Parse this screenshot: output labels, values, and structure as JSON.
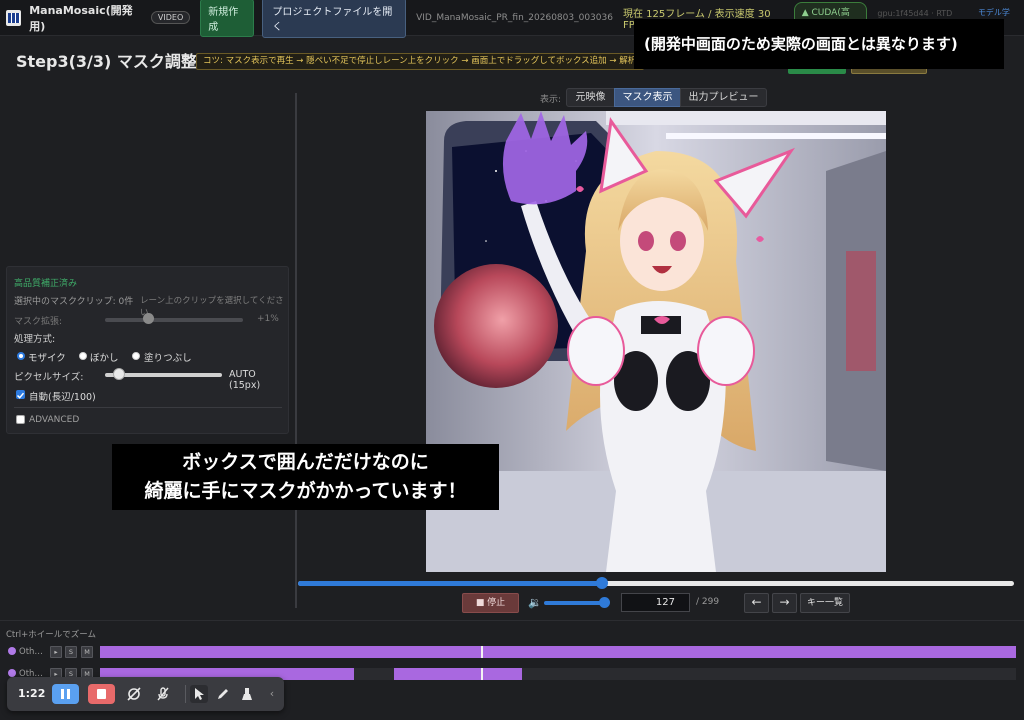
{
  "header": {
    "app_name": "ManaMosaic(開発用)",
    "badge": "VIDEO",
    "new_project_label": "新規作成",
    "open_project_label": "プロジェクトファイルを開く",
    "filename": "VID_ManaMosaic_PR_fin_20260803_003036",
    "frame_status": "現在 125フレーム / 表示速度 30 FPS",
    "cuda_label": "▲ CUDA(高速)",
    "gpu_info": "gpu:1f45d44 · RTD 121/56",
    "model_link": "モデル学習"
  },
  "step": {
    "title": "Step3(3/3) マスク調整",
    "tip": "コツ: マスク表示で再生 → 隠ぺい不足で停止しレーン上をクリック → 画面上でドラッグしてボックス追加 → 解析"
  },
  "overlay": {
    "dev_notice": "(開発中画面のため実際の画面とは異なります)",
    "caption_line1": "ボックスで囲んだだけなのに",
    "caption_line2": "綺麗に手にマスクがかかっています！"
  },
  "left_panel": {
    "status": "高品質補正済み",
    "selected_count": "選択中のマスククリップ: 0件",
    "selected_hint": "レーン上のクリップを選択してください",
    "mask_expand_label": "マスク拡張:",
    "mask_expand_value": "+1%",
    "mask_expand_fraction": 0.28,
    "method_label": "処理方式:",
    "methods": [
      "モザイク",
      "ぼかし",
      "塗りつぶし"
    ],
    "selected_method": "モザイク",
    "pixel_size_label": "ピクセルサイズ:",
    "pixel_size_value": "AUTO (15px)",
    "pixel_size_fraction": 0.12,
    "auto_label": "自動(長辺/100)",
    "auto_checked": true,
    "advanced_label": "ADVANCED",
    "advanced_checked": false
  },
  "view": {
    "label": "表示:",
    "tabs": [
      "元映像",
      "マスク表示",
      "出力プレビュー"
    ],
    "active_tab": "マスク表示"
  },
  "playback": {
    "stop_label": "■ 停止",
    "current_frame": "127",
    "total_frames": "/ 299",
    "prev_label": "←",
    "next_label": "→",
    "keys_label": "キー一覧",
    "progress_fraction": 0.425,
    "volume_fraction": 0.9
  },
  "timeline": {
    "zoom_hint": "Ctrl+ホイールでズーム",
    "tracks": [
      {
        "label": "Oth…",
        "play": "▸",
        "solo": "S",
        "mute": "M"
      },
      {
        "label": "Oth…",
        "play": "▸",
        "solo": "S",
        "mute": "M"
      }
    ]
  },
  "recorder": {
    "elapsed": "1:22"
  },
  "colors": {
    "accent_blue": "#2f7ad8",
    "mask_purple": "#a968e0",
    "tip_yellow": "#e3c45a",
    "status_green": "#3fae6a"
  }
}
